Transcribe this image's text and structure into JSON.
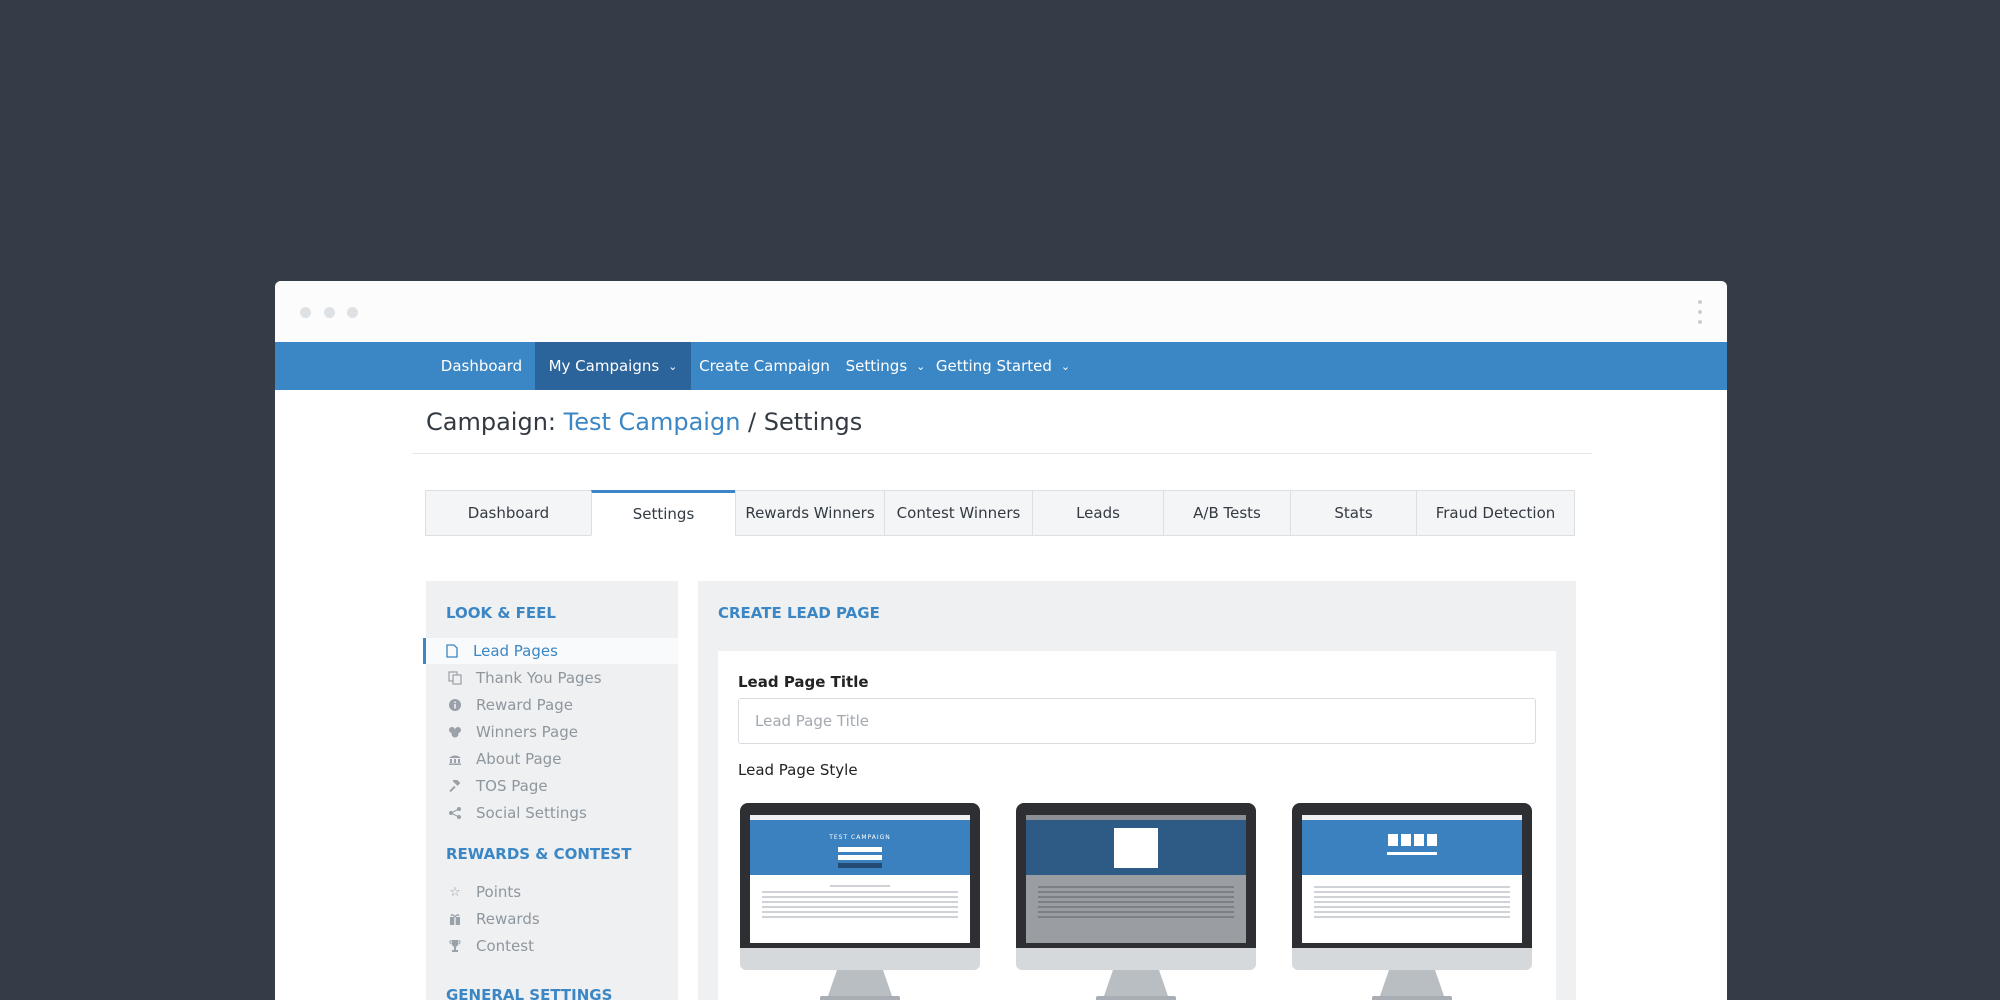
{
  "nav": {
    "items": [
      {
        "label": "Dashboard"
      },
      {
        "label": "My Campaigns"
      },
      {
        "label": "Create Campaign"
      },
      {
        "label": "Settings"
      },
      {
        "label": "Getting Started"
      }
    ]
  },
  "page": {
    "prefix": "Campaign: ",
    "campaign_name": "Test Campaign",
    "suffix": " / Settings"
  },
  "tabs": [
    {
      "label": "Dashboard"
    },
    {
      "label": "Settings",
      "active": true
    },
    {
      "label": "Rewards Winners"
    },
    {
      "label": "Contest Winners"
    },
    {
      "label": "Leads"
    },
    {
      "label": "A/B Tests"
    },
    {
      "label": "Stats"
    },
    {
      "label": "Fraud Detection"
    }
  ],
  "sidebar": {
    "look_feel_heading": "LOOK & FEEL",
    "look_feel": [
      {
        "label": "Lead Pages",
        "icon": "file-icon"
      },
      {
        "label": "Thank You Pages",
        "icon": "copy-icon"
      },
      {
        "label": "Reward Page",
        "icon": "info-icon"
      },
      {
        "label": "Winners Page",
        "icon": "users-icon"
      },
      {
        "label": "About Page",
        "icon": "bank-icon"
      },
      {
        "label": "TOS Page",
        "icon": "gavel-icon"
      },
      {
        "label": "Social Settings",
        "icon": "share-icon"
      }
    ],
    "rewards_heading": "REWARDS & CONTEST",
    "rewards": [
      {
        "label": "Points",
        "icon": "star-icon"
      },
      {
        "label": "Rewards",
        "icon": "gift-icon"
      },
      {
        "label": "Contest",
        "icon": "trophy-icon"
      }
    ],
    "general_heading": "GENERAL SETTINGS"
  },
  "main": {
    "heading": "CREATE LEAD PAGE",
    "title_label": "Lead Page Title",
    "title_placeholder": "Lead Page Title",
    "style_label": "Lead Page Style"
  },
  "colors": {
    "background": "#343d47",
    "primary": "#3b86c4",
    "nav_active": "#2a649a"
  }
}
